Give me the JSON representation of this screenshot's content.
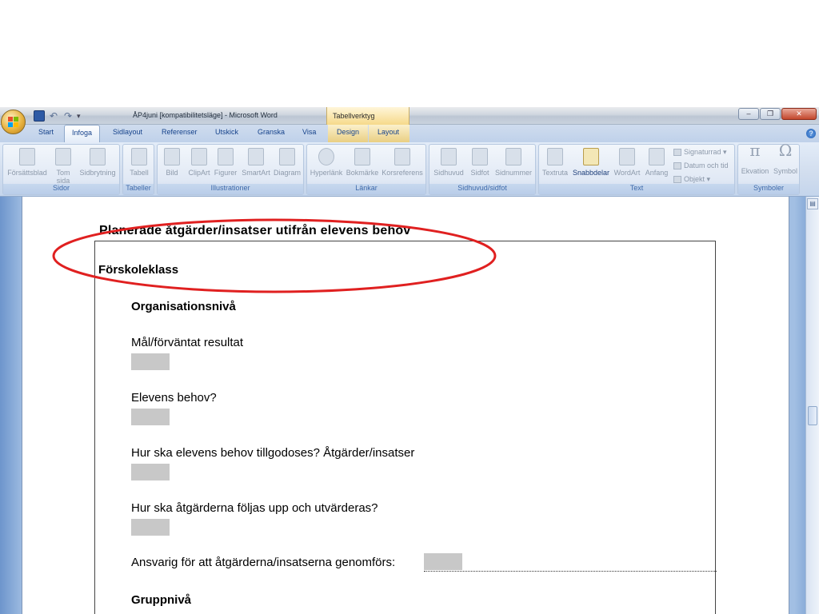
{
  "window": {
    "title": "ÅP4juni [kompatibilitetsläge] - Microsoft Word",
    "context_tab": "Tabellverktyg"
  },
  "qat": {
    "undo": "↶",
    "redo": "↷",
    "more": "▾"
  },
  "tabs": [
    {
      "label": "Start"
    },
    {
      "label": "Infoga"
    },
    {
      "label": "Sidlayout"
    },
    {
      "label": "Referenser"
    },
    {
      "label": "Utskick"
    },
    {
      "label": "Granska"
    },
    {
      "label": "Visa"
    },
    {
      "label": "Design"
    },
    {
      "label": "Layout"
    }
  ],
  "ribbon": {
    "groups": {
      "sidor": "Sidor",
      "tabeller": "Tabeller",
      "illustrationer": "Illustrationer",
      "lankar": "Länkar",
      "sidhuvud": "Sidhuvud/sidfot",
      "text": "Text",
      "symboler": "Symboler"
    },
    "buttons": {
      "forsattsblad": "Försättsblad",
      "tom_sida": "Tom sida",
      "sidbrytning": "Sidbrytning",
      "tabell": "Tabell",
      "bild": "Bild",
      "clipart": "ClipArt",
      "figurer": "Figurer",
      "smartart": "SmartArt",
      "diagram": "Diagram",
      "hyperlank": "Hyperlänk",
      "bokmarke": "Bokmärke",
      "korsreferens": "Korsreferens",
      "sidhuvud": "Sidhuvud",
      "sidfot": "Sidfot",
      "sidnummer": "Sidnummer",
      "textruta": "Textruta",
      "snabbdelar": "Snabbdelar",
      "wordart": "WordArt",
      "anfang": "Anfang",
      "signaturrad": "Signaturrad",
      "datum": "Datum och tid",
      "objekt": "Objekt",
      "ekvation": "Ekvation",
      "symbol": "Symbol"
    }
  },
  "document": {
    "heading": "Planerade åtgärder/insatser utifrån elevens behov",
    "section": "Förskoleklass",
    "subsection1": "Organisationsnivå",
    "q1": "Mål/förväntat resultat",
    "q2": "Elevens behov?",
    "q3": "Hur ska elevens behov tillgodoses? Åtgärder/insatser",
    "q4": "Hur ska åtgärderna följas upp och utvärderas?",
    "q5": "Ansvarig för att åtgärderna/insatserna genomförs:",
    "subsection2": "Gruppnivå"
  },
  "colors": {
    "annotation": "#e02020",
    "field_gray": "#c8c8c8"
  }
}
